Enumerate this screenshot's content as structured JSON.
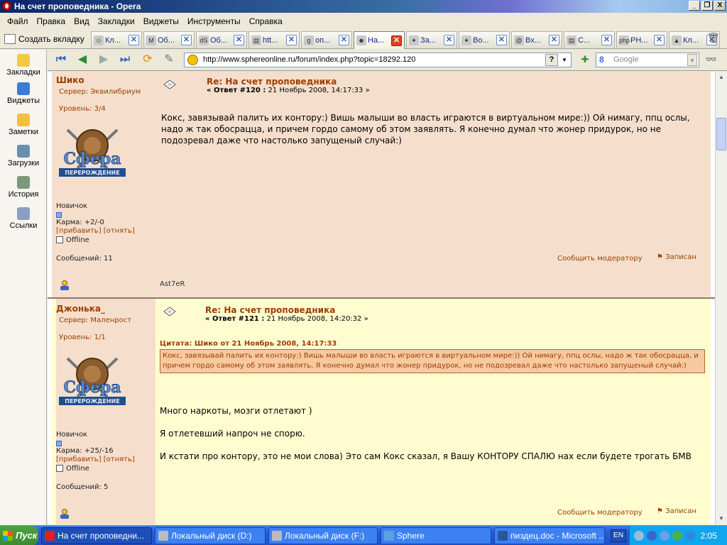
{
  "window": {
    "title": "На счет проповедника - Opera",
    "controls": [
      "_",
      "❐",
      "X"
    ]
  },
  "menu": [
    "Файл",
    "Правка",
    "Вид",
    "Закладки",
    "Виджеты",
    "Инструменты",
    "Справка"
  ],
  "newtab_label": "Создать вкладку",
  "tabs": [
    {
      "title": "Кл...",
      "icon": "smiley-icon",
      "active": false
    },
    {
      "title": "Об...",
      "icon": "m-logo-icon",
      "active": false
    },
    {
      "title": "Об...",
      "icon": "ds-logo-icon",
      "active": false
    },
    {
      "title": "htt...",
      "icon": "page-icon",
      "active": false
    },
    {
      "title": "оп...",
      "icon": "google-icon",
      "active": false
    },
    {
      "title": "На...",
      "icon": "opera-forum-icon",
      "active": true
    },
    {
      "title": "За...",
      "icon": "runner-icon",
      "active": false
    },
    {
      "title": "Во...",
      "icon": "runner-icon",
      "active": false
    },
    {
      "title": "Вх...",
      "icon": "at-icon",
      "active": false
    },
    {
      "title": "С...",
      "icon": "page-icon",
      "active": false
    },
    {
      "title": "PH...",
      "icon": "php-icon",
      "active": false
    },
    {
      "title": "Кл...",
      "icon": "grad-cap-icon",
      "active": false
    }
  ],
  "panel": [
    {
      "label": "Закладки",
      "icon": "bookmarks-icon"
    },
    {
      "label": "Виджеты",
      "icon": "widgets-icon"
    },
    {
      "label": "Заметки",
      "icon": "notes-icon"
    },
    {
      "label": "Загрузки",
      "icon": "downloads-icon"
    },
    {
      "label": "История",
      "icon": "history-icon"
    },
    {
      "label": "Ссылки",
      "icon": "links-icon"
    }
  ],
  "address": {
    "url": "http://www.sphereonline.ru/forum/index.php?topic=18292.120",
    "help": "?"
  },
  "search": {
    "placeholder": "Google",
    "engine_icon": "8"
  },
  "posts": [
    {
      "author": "Шико",
      "server": "Сервер: Эквилибриум",
      "level": "Уровень: 3/4",
      "logo": "Сфера",
      "logo_sub": "ПЕРЕРОЖДЕНИЕ",
      "rank": "Новичок",
      "karma": "Карма: +2/-0",
      "karma_links": "[прибавить] [отнять]",
      "status": "Offline",
      "messages": "Сообщений: 11",
      "title": "Re: На счет проповедника",
      "meta_prefix": "« Ответ #120 :",
      "meta_date": "21 Ноябрь 2008, 14:17:33 »",
      "body": "Кокс, завязывай палить их контору:) Вишь малыши во власть играются в виртуальном мире:)) Ой нимагу, ппц ослы, надо ж так обосрацца, и причем гордо самому об этом заявлять. Я конечно думал что жонер придурок, но не подозревал даже что настолько запущеный случай:)",
      "report": "Сообщить модератору",
      "logged": "Записан",
      "signature": "Ast7eR"
    },
    {
      "author": "Джонька_",
      "server": "Сервер: Маленрост",
      "level": "Уровень: 1/1",
      "logo": "Сфера",
      "logo_sub": "ПЕРЕРОЖДЕНИЕ",
      "rank": "Новичок",
      "karma": "Карма: +25/-16",
      "karma_links": "[прибавить] [отнять]",
      "status": "Offline",
      "messages": "Сообщений: 5",
      "title": "Re: На счет проповедника",
      "meta_prefix": "« Ответ #121 :",
      "meta_date": "21 Ноябрь 2008, 14:20:32 »",
      "quote_header": "Цитата: Шико от 21 Ноябрь 2008, 14:17:33",
      "quote": "Кокс, завязывай палить их контору:) Вишь малыши во власть играются в виртуальном мире:)) Ой нимагу, ппц ослы, надо ж так обосрацца, и причем гордо самому об этом заявлять. Я конечно думал что жонер придурок, но не подозревал даже что настолько запущеный случай:)",
      "lines": [
        "Много наркоты, мозги отлетают )",
        "Я отлетевший напроч не спорю.",
        "И кстати про контору, это не мои слова) Это сам Кокс сказал, я Вашу КОНТОРУ СПАЛЮ нах если будете трогать БМВ"
      ],
      "report": "Сообщить модератору",
      "logged": "Записан"
    }
  ],
  "taskbar": {
    "start": "Пуск",
    "tasks": [
      {
        "label": "На счет проповедни...",
        "icon": "opera-icon",
        "active": true
      },
      {
        "label": "Локальный диск (D:)",
        "icon": "drive-icon",
        "active": false
      },
      {
        "label": "Локальный диск (F:)",
        "icon": "drive-icon",
        "active": false
      },
      {
        "label": "Sphere",
        "icon": "sphere-icon",
        "active": false
      },
      {
        "label": "пиздец.doc - Microsoft ...",
        "icon": "word-icon",
        "active": false
      }
    ],
    "lang": "EN",
    "clock": "2:05"
  }
}
